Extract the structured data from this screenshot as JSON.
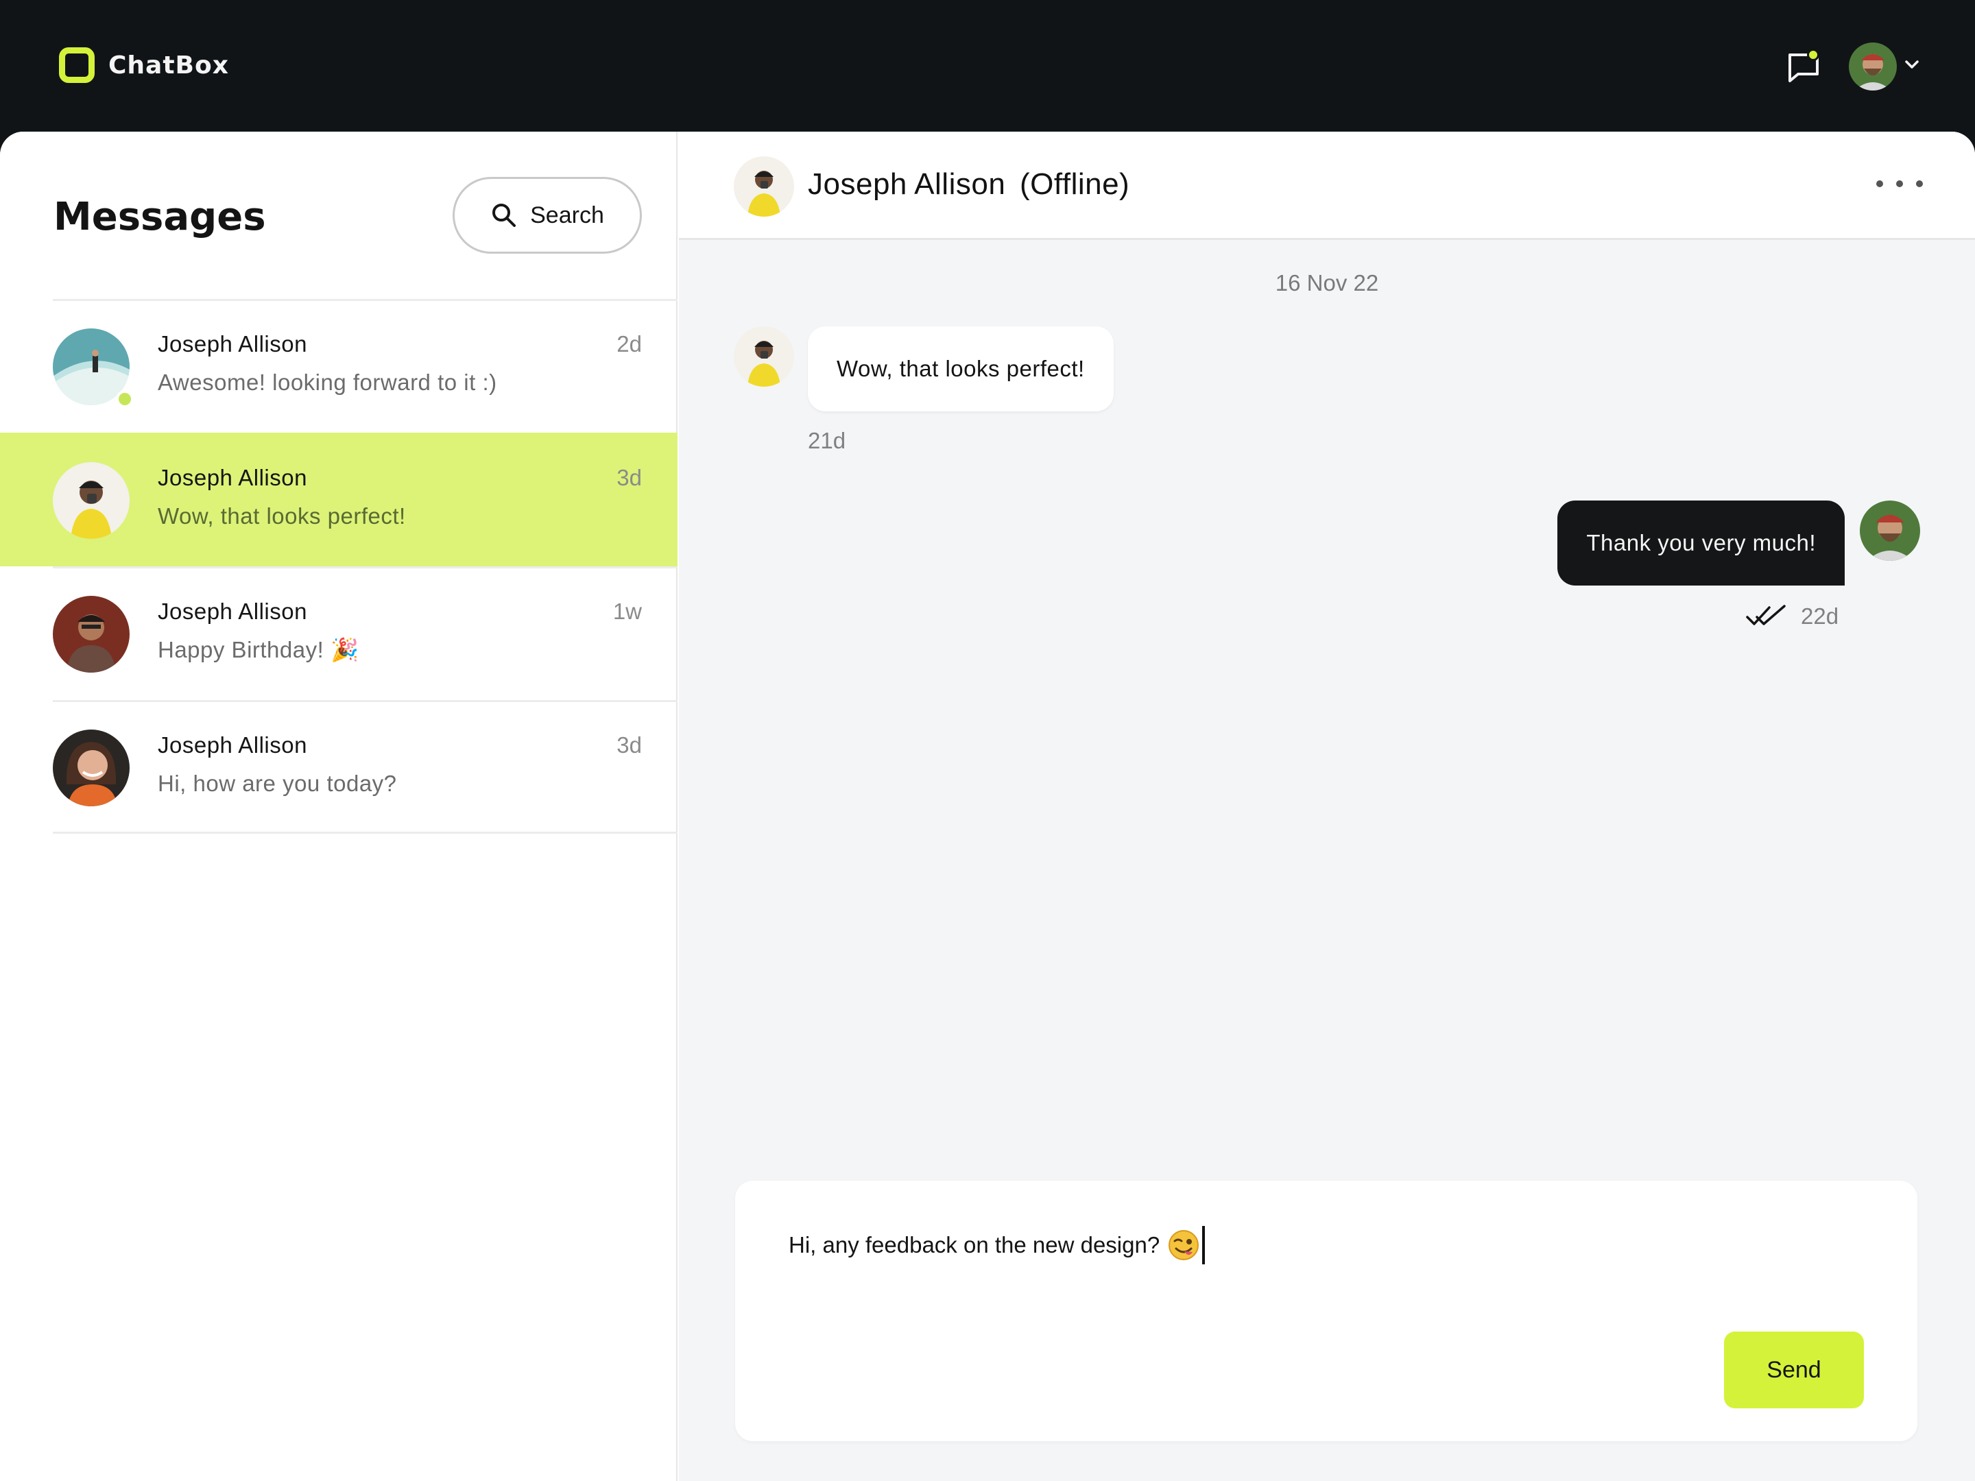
{
  "app": {
    "name": "ChatBox"
  },
  "colors": {
    "accent": "#d4f23a",
    "active_row": "#dcf378",
    "topbar": "#111416",
    "online": "#c6e65a"
  },
  "header": {
    "notifications_icon": "chat-bubble-icon",
    "user_menu_icon": "chevron-down-icon"
  },
  "sidebar": {
    "title": "Messages",
    "search_label": "Search",
    "conversations": [
      {
        "name": "Joseph Allison",
        "preview": "Awesome! looking forward to it :)",
        "time": "2d",
        "online": true,
        "active": false
      },
      {
        "name": "Joseph Allison",
        "preview": "Wow, that looks perfect!",
        "time": "3d",
        "online": false,
        "active": true
      },
      {
        "name": "Joseph Allison",
        "preview": "Happy Birthday! 🎉",
        "time": "1w",
        "online": false,
        "active": false
      },
      {
        "name": "Joseph Allison",
        "preview": "Hi, how are you today?",
        "time": "3d",
        "online": false,
        "active": false
      }
    ]
  },
  "chat": {
    "contact_name": "Joseph Allison",
    "contact_status": "(Offline)",
    "date_separator": "16 Nov 22",
    "messages": [
      {
        "direction": "in",
        "text": "Wow, that looks perfect!",
        "time": "21d"
      },
      {
        "direction": "out",
        "text": "Thank you very much!",
        "time": "22d",
        "read": true
      }
    ],
    "composer": {
      "value": "Hi, any feedback on the new design?",
      "emoji": "winking-face-with-tongue",
      "send_label": "Send"
    }
  }
}
